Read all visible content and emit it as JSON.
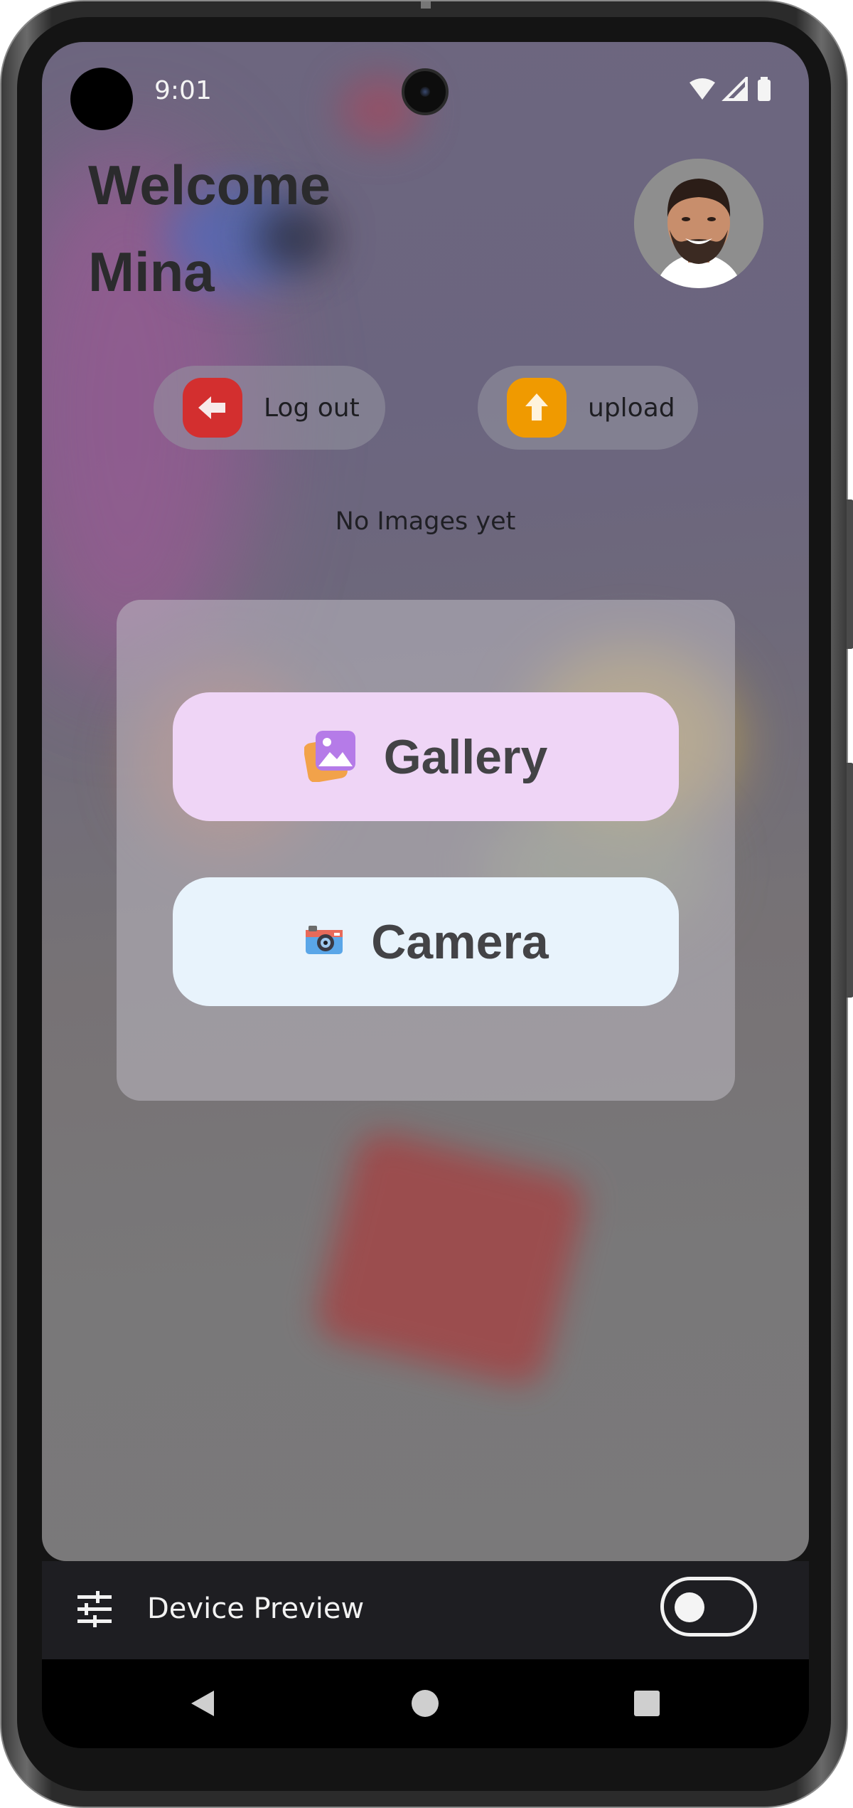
{
  "status_bar": {
    "time": "9:01",
    "icons": [
      "wifi-icon",
      "signal-icon",
      "battery-icon"
    ]
  },
  "header": {
    "welcome_line1": "Welcome",
    "welcome_line2": "Mina",
    "avatar": "user-avatar"
  },
  "actions": {
    "logout_label": "Log out",
    "logout_icon": "arrow-left-icon",
    "logout_color": "#d32f2f",
    "upload_label": "upload",
    "upload_icon": "arrow-up-icon",
    "upload_color": "#f09a00"
  },
  "main": {
    "empty_message": "No Images yet"
  },
  "picker_dialog": {
    "gallery_label": "Gallery",
    "gallery_icon": "gallery-icon",
    "gallery_color": "#efd5f6",
    "camera_label": "Camera",
    "camera_icon": "camera-icon",
    "camera_color": "#e8f3fc"
  },
  "device_preview": {
    "label": "Device Preview",
    "icon": "sliders-icon",
    "toggle_on": false
  },
  "nav": {
    "back": "back-icon",
    "home": "home-icon",
    "recents": "recents-icon"
  }
}
